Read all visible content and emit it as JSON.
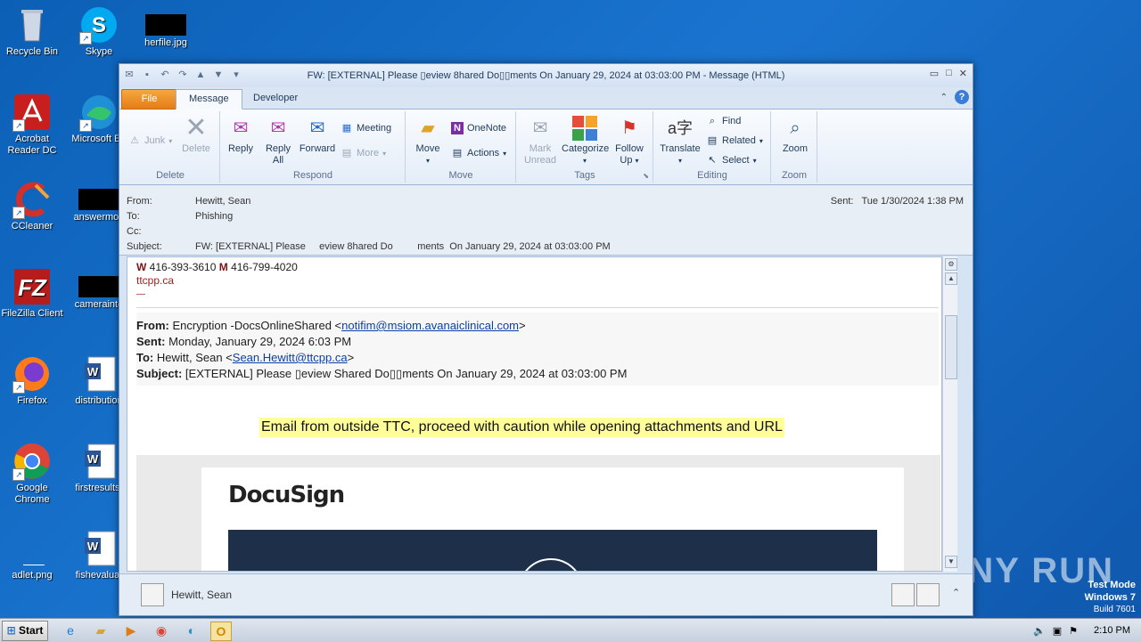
{
  "desktop": {
    "icons": [
      {
        "label": "Recycle Bin",
        "icon": "recycle-bin-icon"
      },
      {
        "label": "Skype",
        "icon": "skype-icon"
      },
      {
        "label": "herfile.jpg",
        "icon": "image-file-icon"
      },
      {
        "label": "Acrobat Reader DC",
        "icon": "acrobat-icon"
      },
      {
        "label": "Microsoft Ed",
        "icon": "edge-icon"
      },
      {
        "label": "CCleaner",
        "icon": "ccleaner-icon"
      },
      {
        "label": "answermon",
        "icon": "file-icon"
      },
      {
        "label": "FileZilla Client",
        "icon": "filezilla-icon"
      },
      {
        "label": "camerainte",
        "icon": "file-icon"
      },
      {
        "label": "Firefox",
        "icon": "firefox-icon"
      },
      {
        "label": "distribution",
        "icon": "word-doc-icon"
      },
      {
        "label": "Google Chrome",
        "icon": "chrome-icon"
      },
      {
        "label": "firstresults.",
        "icon": "word-doc-icon"
      },
      {
        "label": "adlet.png",
        "icon": "image-file-icon"
      },
      {
        "label": "fishevaluat",
        "icon": "word-doc-icon"
      }
    ],
    "watermark": "ANY RUN",
    "test_mode": [
      "Test Mode",
      "Windows 7",
      "Build 7601"
    ]
  },
  "window": {
    "title": "FW: [EXTERNAL] Please \u0000eview 8hared Do\u0000\u0000ments  On January 29, 2024 at 03:03:00 PM  -  Message (HTML)",
    "title_display": "FW: [EXTERNAL] Please ▯eview 8hared Do▯▯ments  On January 29, 2024 at 03:03:00 PM  -  Message (HTML)",
    "tabs": {
      "file": "File",
      "message": "Message",
      "developer": "Developer"
    },
    "ribbon": {
      "delete_group": {
        "label": "Delete",
        "junk": "Junk",
        "delete": "Delete"
      },
      "respond_group": {
        "label": "Respond",
        "reply": "Reply",
        "reply_all_1": "Reply",
        "reply_all_2": "All",
        "forward": "Forward",
        "meeting": "Meeting",
        "more": "More"
      },
      "move_group": {
        "label": "Move",
        "move": "Move",
        "onenote": "OneNote",
        "actions": "Actions"
      },
      "tags_group": {
        "label": "Tags",
        "mark_unread_1": "Mark",
        "mark_unread_2": "Unread",
        "categorize": "Categorize",
        "follow_up_1": "Follow",
        "follow_up_2": "Up"
      },
      "editing_group": {
        "label": "Editing",
        "translate": "Translate",
        "find": "Find",
        "related": "Related",
        "select": "Select"
      },
      "zoom_group": {
        "label": "Zoom",
        "zoom": "Zoom"
      }
    },
    "header": {
      "from_label": "From:",
      "from": "Hewitt, Sean",
      "to_label": "To:",
      "to": "Phishing",
      "cc_label": "Cc:",
      "cc": "",
      "subject_label": "Subject:",
      "subject": "FW: [EXTERNAL] Please     eview 8hared Do         ments  On January 29, 2024 at 03:03:00 PM",
      "sent_label": "Sent:",
      "sent": "Tue 1/30/2024 1:38 PM"
    },
    "body": {
      "sig_w": "W",
      "sig_w_num": " 416-393-3610 ",
      "sig_m": "M",
      "sig_m_num": " 416-799-4020",
      "sig_site": "ttcpp.ca",
      "sig_dash": "—",
      "fwd_from_label": "From:",
      "fwd_from_text": " Encryption -DocsOnlineShared <",
      "fwd_from_email": "notifim@msiom.avanaiclinical.com",
      "fwd_from_close": ">",
      "fwd_sent_label": "Sent:",
      "fwd_sent": " Monday, January 29, 2024 6:03 PM",
      "fwd_to_label": "To:",
      "fwd_to_text": " Hewitt, Sean <",
      "fwd_to_email": "Sean.Hewitt@ttcpp.ca",
      "fwd_to_close": ">",
      "fwd_subject_label": "Subject:",
      "fwd_subject": " [EXTERNAL] Please ▯eview Shared Do▯▯ments On January 29, 2024 at 03:03:00 PM",
      "caution": "Email from outside TTC, proceed with caution while opening attachments and URL",
      "docusign_logo": "DocuSign"
    },
    "people_pane": {
      "name": "Hewitt, Sean"
    }
  },
  "taskbar": {
    "start": "Start",
    "clock": "2:10 PM"
  }
}
